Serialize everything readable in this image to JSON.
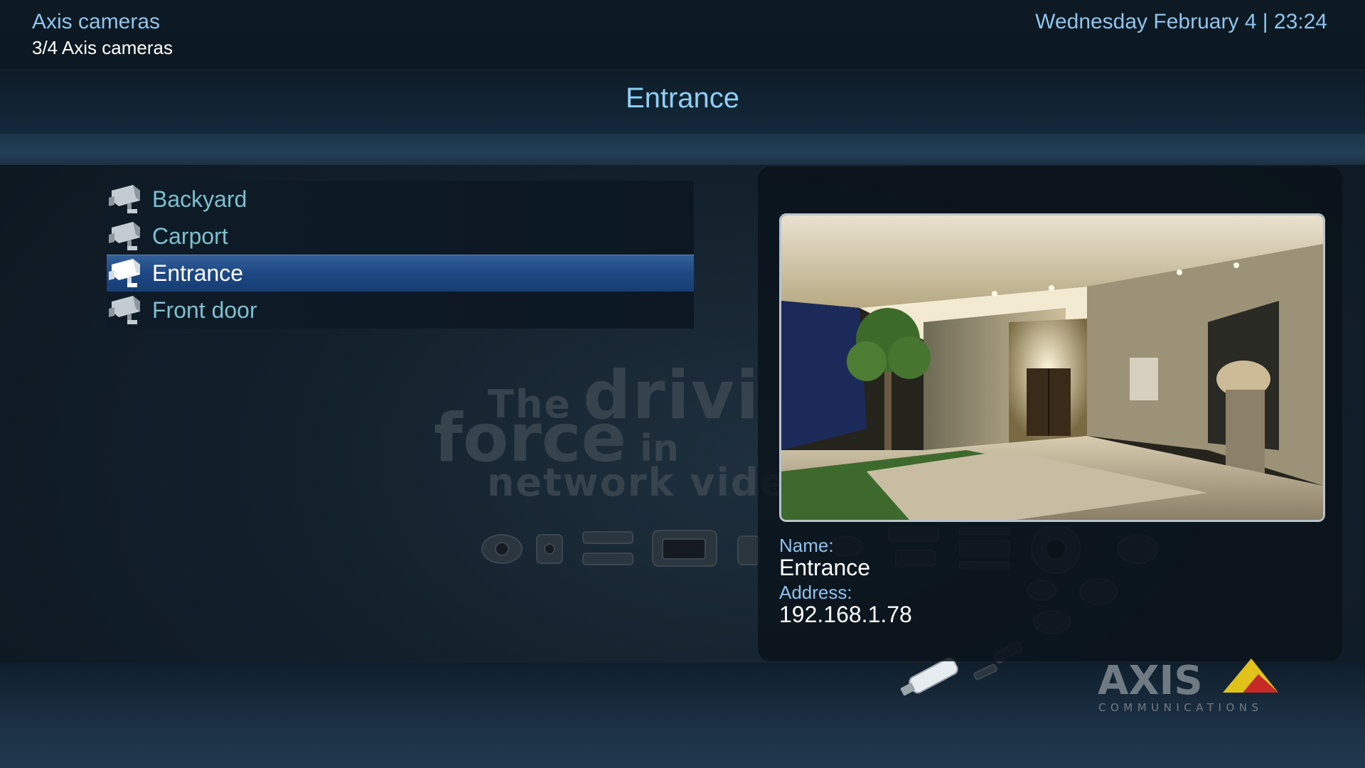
{
  "header": {
    "app_title": "Axis cameras",
    "subtitle": "3/4 Axis cameras",
    "datetime": "Wednesday February 4 | 23:24"
  },
  "page_title": "Entrance",
  "cameras": [
    {
      "label": "Backyard",
      "selected": false
    },
    {
      "label": "Carport",
      "selected": false
    },
    {
      "label": "Entrance",
      "selected": true
    },
    {
      "label": "Front door",
      "selected": false
    }
  ],
  "details": {
    "name_label": "Name:",
    "name_value": "Entrance",
    "address_label": "Address:",
    "address_value": "192.168.1.78"
  },
  "watermark": {
    "line1a": "The",
    "line1b": "drivi",
    "line2a": "force",
    "line2b": "in",
    "line3": "network vide"
  },
  "logo": {
    "wordmark": "AXIS",
    "tagline": "COMMUNICATIONS"
  },
  "colors": {
    "accent": "#8fc4ec",
    "selected_row": "#1f4a86",
    "list_text": "#7cc0d0"
  }
}
